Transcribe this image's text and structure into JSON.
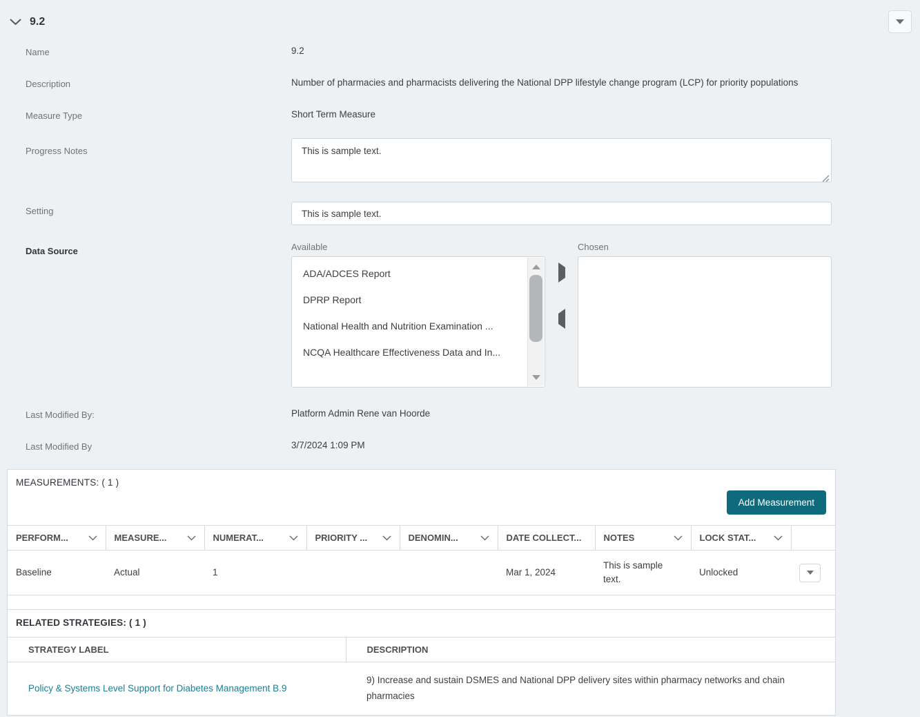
{
  "header": {
    "title": "9.2"
  },
  "form": {
    "name_label": "Name",
    "name_value": "9.2",
    "description_label": "Description",
    "description_value": "Number of pharmacies and pharmacists delivering the National DPP lifestyle change program (LCP) for priority populations",
    "measure_type_label": "Measure Type",
    "measure_type_value": "Short Term Measure",
    "progress_notes_label": "Progress Notes",
    "progress_notes_value": "This is sample text.",
    "setting_label": "Setting",
    "setting_value": "This is sample text.",
    "data_source_label": "Data Source",
    "available_label": "Available",
    "chosen_label": "Chosen",
    "available_options": [
      "ADA/ADCES Report",
      "DPRP Report",
      "National Health and Nutrition Examination ...",
      "NCQA Healthcare Effectiveness Data and In..."
    ],
    "last_modified_by_label": "Last Modified By:",
    "last_modified_by_value": "Platform Admin Rene van Hoorde",
    "last_modified_date_label": "Last Modified By",
    "last_modified_date_value": "3/7/2024 1:09 PM"
  },
  "measurements": {
    "section_title": "MEASUREMENTS: ( 1 )",
    "add_button_label": "Add Measurement",
    "columns": [
      "PERFORM...",
      "MEASURE...",
      "NUMERAT...",
      "PRIORITY ...",
      "DENOMIN...",
      "DATE COLLECT...",
      "NOTES",
      "LOCK STAT..."
    ],
    "rows": [
      [
        "Baseline",
        "Actual",
        "1",
        "",
        "",
        "Mar 1, 2024",
        "This is sample text.",
        "Unlocked"
      ]
    ]
  },
  "related_strategies": {
    "section_title": "RELATED STRATEGIES: ( 1 )",
    "columns": [
      "STRATEGY LABEL",
      "DESCRIPTION"
    ],
    "rows": [
      {
        "label": "Policy & Systems Level Support for Diabetes Management B.9",
        "description": "9) Increase and sustain DSMES and National DPP delivery sites within pharmacy networks and chain pharmacies"
      }
    ]
  },
  "colors": {
    "accent_teal": "#0f6b7c",
    "link_teal": "#1b7e96",
    "page_background": "#edf1f4"
  }
}
